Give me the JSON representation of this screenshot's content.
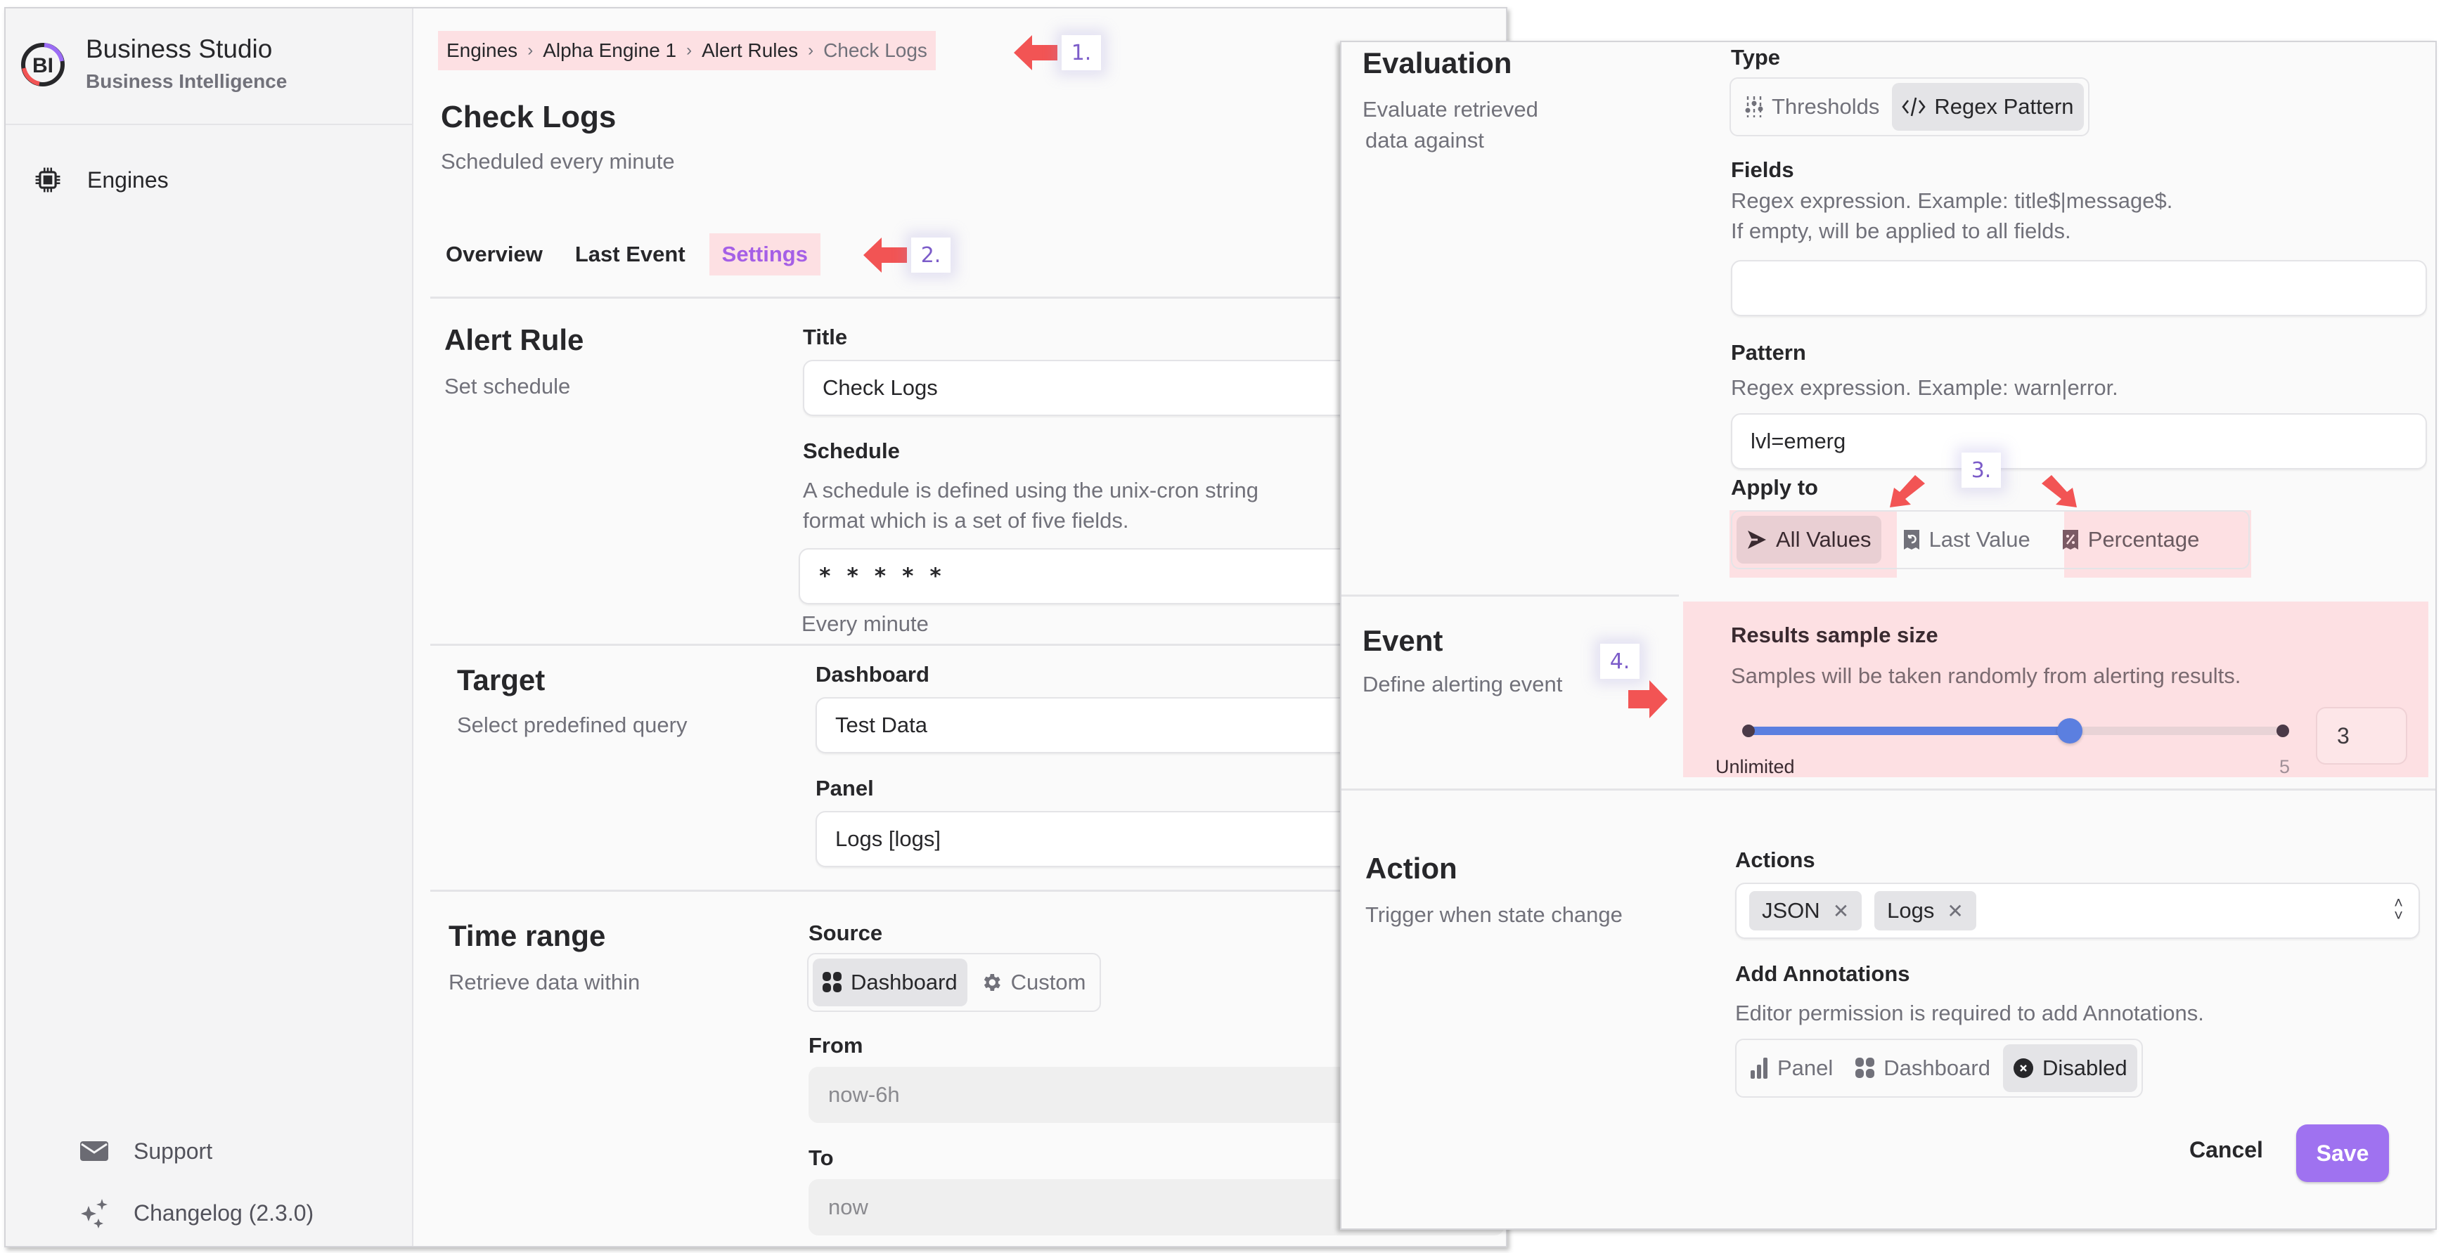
{
  "app": {
    "title": "Business Studio",
    "subtitle": "Business Intelligence",
    "logo_text": "BI"
  },
  "sidebar": {
    "items": [
      {
        "label": "Engines",
        "icon": "chip-icon"
      }
    ],
    "footer": [
      {
        "label": "Support",
        "icon": "envelope-icon"
      },
      {
        "label": "Changelog (2.3.0)",
        "icon": "sparkles-icon"
      }
    ]
  },
  "breadcrumb": [
    "Engines",
    "Alpha Engine 1",
    "Alert Rules",
    "Check Logs"
  ],
  "page": {
    "title": "Check Logs",
    "subtitle": "Scheduled every minute"
  },
  "tabs": [
    {
      "label": "Overview",
      "active": false
    },
    {
      "label": "Last Event",
      "active": false
    },
    {
      "label": "Settings",
      "active": true
    }
  ],
  "annotations": [
    "1.",
    "2.",
    "3.",
    "4."
  ],
  "alert_rule": {
    "title": "Alert Rule",
    "desc": "Set schedule",
    "title_label": "Title",
    "title_value": "Check Logs",
    "schedule_label": "Schedule",
    "schedule_help_1": "A schedule is defined using the unix-cron string",
    "schedule_help_2": "format which is a set of five fields.",
    "schedule_value": "* * * * *",
    "schedule_hint": "Every minute"
  },
  "target": {
    "title": "Target",
    "desc": "Select predefined query",
    "dashboard_label": "Dashboard",
    "dashboard_value": "Test Data",
    "panel_label": "Panel",
    "panel_value": "Logs [logs]"
  },
  "time_range": {
    "title": "Time range",
    "desc": "Retrieve data within",
    "source_label": "Source",
    "source_options": [
      {
        "label": "Dashboard",
        "icon": "grid-icon",
        "active": true
      },
      {
        "label": "Custom",
        "icon": "gear-icon",
        "active": false
      }
    ],
    "from_label": "From",
    "from_value": "now-6h",
    "to_label": "To",
    "to_value": "now"
  },
  "evaluation": {
    "title": "Evaluation",
    "desc_1": "Evaluate retrieved",
    "desc_2": "data against",
    "type_label": "Type",
    "type_options": [
      {
        "label": "Thresholds",
        "icon": "sliders-icon",
        "active": false
      },
      {
        "label": "Regex Pattern",
        "icon": "code-icon",
        "active": true
      }
    ],
    "fields_label": "Fields",
    "fields_help_1": "Regex expression. Example: title$|message$.",
    "fields_help_2": "If empty, will be applied to all fields.",
    "fields_value": "",
    "pattern_label": "Pattern",
    "pattern_help": "Regex expression. Example: warn|error.",
    "pattern_value": "lvl=emerg",
    "apply_label": "Apply to",
    "apply_options": [
      {
        "label": "All Values",
        "icon": "send-icon",
        "active": true
      },
      {
        "label": "Last Value",
        "icon": "receipt-refund-icon",
        "active": false
      },
      {
        "label": "Percentage",
        "icon": "receipt-percent-icon",
        "active": false
      }
    ]
  },
  "event": {
    "title": "Event",
    "desc": "Define alerting event",
    "sample_label": "Results sample size",
    "sample_help": "Samples will be taken randomly from alerting results.",
    "slider_min_label": "Unlimited",
    "slider_max_label": "5",
    "slider_min": 0,
    "slider_max": 5,
    "slider_value": 3,
    "value_display": "3"
  },
  "action": {
    "title": "Action",
    "desc": "Trigger when state change",
    "actions_label": "Actions",
    "actions": [
      "JSON",
      "Logs"
    ],
    "annotations_label": "Add Annotations",
    "annotations_help": "Editor permission is required to add Annotations.",
    "annotation_options": [
      {
        "label": "Panel",
        "icon": "bar-chart-icon",
        "active": false
      },
      {
        "label": "Dashboard",
        "icon": "grid-icon",
        "active": false
      },
      {
        "label": "Disabled",
        "icon": "x-circle-icon",
        "active": true
      }
    ]
  },
  "buttons": {
    "cancel": "Cancel",
    "save": "Save"
  },
  "colors": {
    "accent": "#9f72f0",
    "tab_active": "#a55fe6",
    "highlight": "#fde0e3",
    "annotation_arrow": "#f25454",
    "slider": "#5b7fe0"
  }
}
